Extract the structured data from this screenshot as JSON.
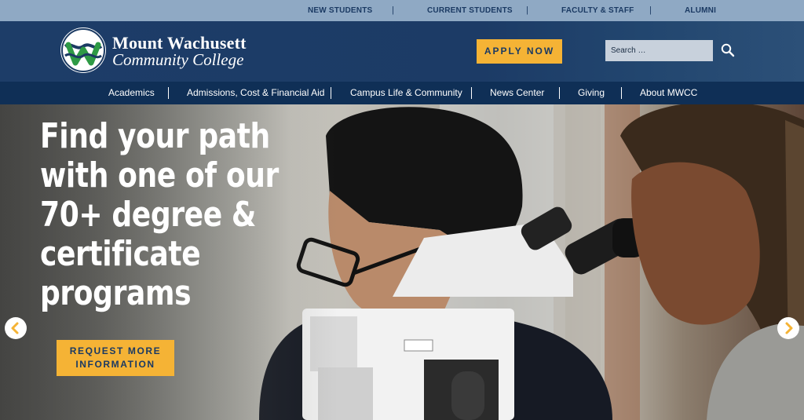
{
  "utility_nav": {
    "items": [
      "NEW STUDENTS",
      "CURRENT STUDENTS",
      "FACULTY & STAFF",
      "ALUMNI"
    ],
    "separator": "|"
  },
  "header": {
    "logo_title": "Mount Wachusett",
    "logo_subtitle": "Community College",
    "apply_label": "APPLY NOW",
    "search_placeholder": "Search …",
    "search_icon": "search-icon"
  },
  "main_nav": {
    "items": [
      "Academics",
      "Admissions, Cost & Financial Aid",
      "Campus Life & Community",
      "News Center",
      "Giving",
      "About MWCC"
    ]
  },
  "hero": {
    "headline": "Find your path with one of our 70+ degree & certificate programs",
    "cta_label": "REQUEST MORE INFORMATION",
    "prev_icon": "chevron-left-icon",
    "next_icon": "chevron-right-icon"
  },
  "colors": {
    "navy": "#1b3a63",
    "nav_dark": "#0f2f56",
    "utility_bg": "#8fa9c4",
    "accent_gold": "#f5b335",
    "logo_green": "#2e9a45"
  }
}
